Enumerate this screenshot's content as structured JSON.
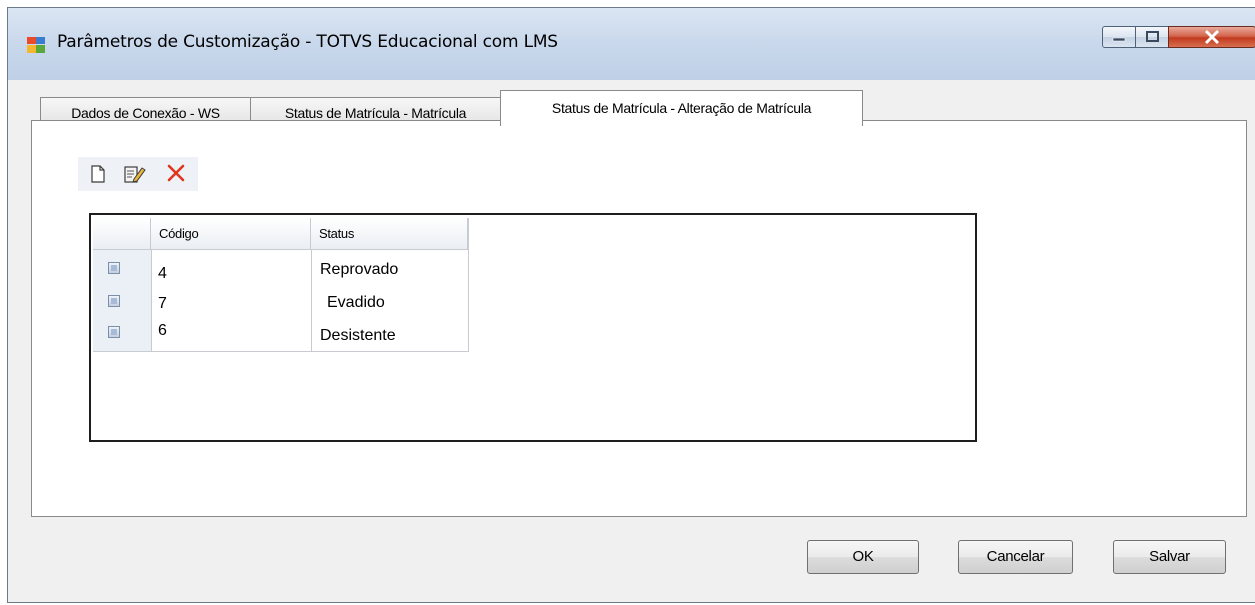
{
  "window": {
    "title": "Parâmetros de Customização - TOTVS Educacional com LMS"
  },
  "tabs": [
    {
      "label": "Dados de Conexão - WS",
      "active": false
    },
    {
      "label": "Status de Matrícula - Matrícula",
      "active": false
    },
    {
      "label": "Status de Matrícula - Alteração de Matrícula",
      "active": true
    }
  ],
  "toolbar": {
    "icons": [
      "new-document-icon",
      "edit-icon",
      "delete-icon"
    ]
  },
  "grid": {
    "columns": [
      "Código",
      "Status"
    ],
    "rows": [
      {
        "codigo": "4",
        "status": "Reprovado"
      },
      {
        "codigo": "7",
        "status": "Evadido"
      },
      {
        "codigo": "6",
        "status": "Desistente"
      }
    ]
  },
  "buttons": {
    "ok": "OK",
    "cancel": "Cancelar",
    "save": "Salvar"
  },
  "colors": {
    "delete_icon": "#e0351e",
    "titlebar": "#cad9ec",
    "close_button": "#c23a1f"
  }
}
